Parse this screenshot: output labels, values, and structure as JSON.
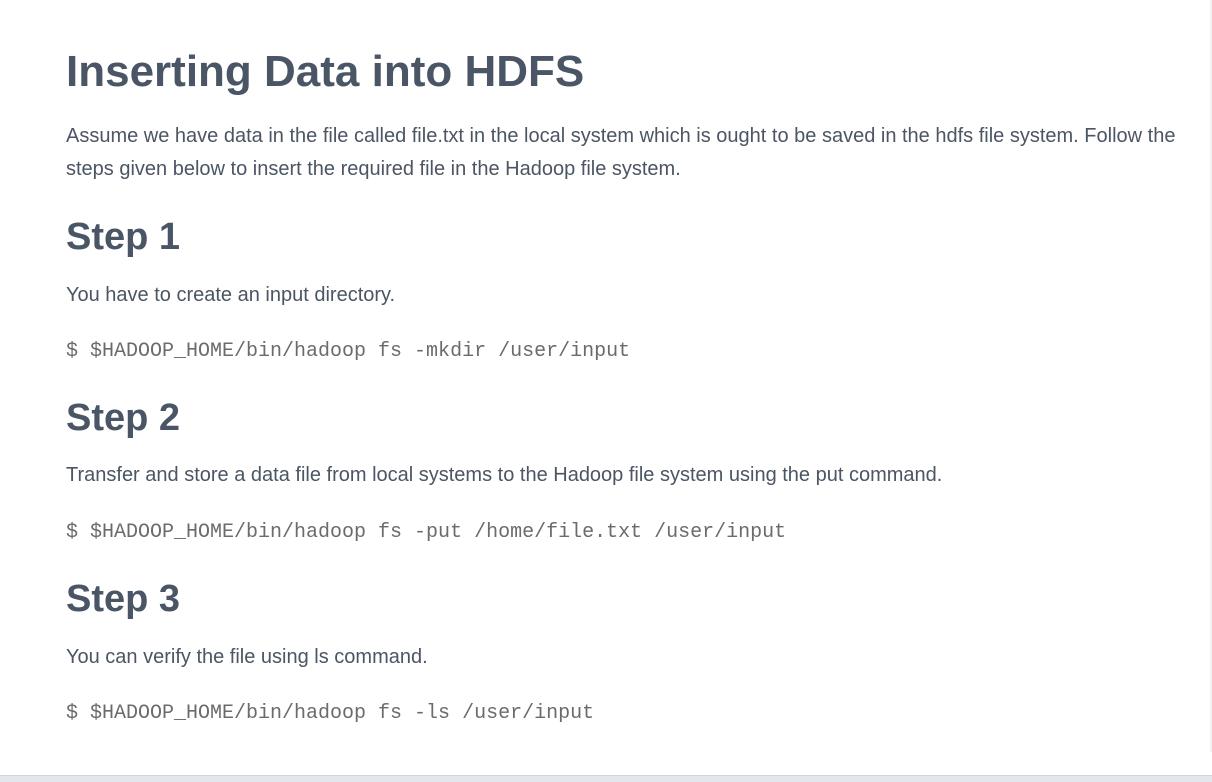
{
  "article": {
    "title": "Inserting Data into HDFS",
    "intro": "Assume we have data in the file called file.txt in the local system which is ought to be saved in the hdfs file system. Follow the steps given below to insert the required file in the Hadoop file system.",
    "steps": [
      {
        "heading": "Step 1",
        "text": "You have to create an input directory.",
        "code": "$ $HADOOP_HOME/bin/hadoop fs -mkdir /user/input"
      },
      {
        "heading": "Step 2",
        "text": "Transfer and store a data file from local systems to the Hadoop file system using the put command.",
        "code": "$ $HADOOP_HOME/bin/hadoop fs -put /home/file.txt /user/input"
      },
      {
        "heading": "Step 3",
        "text": "You can verify the file using ls command.",
        "code": "$ $HADOOP_HOME/bin/hadoop fs -ls /user/input"
      }
    ]
  }
}
